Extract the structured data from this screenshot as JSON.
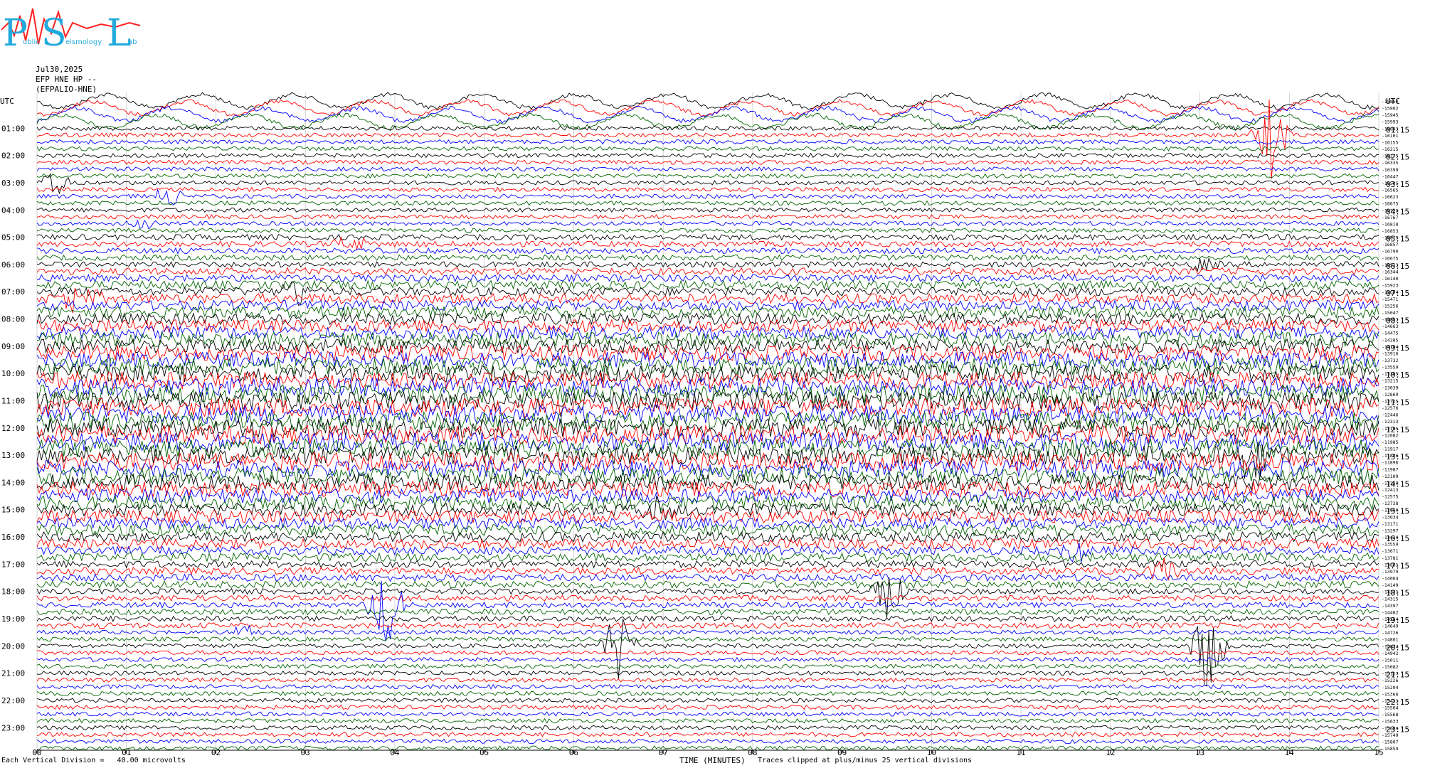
{
  "logo": {
    "text_p": "P",
    "text_s": "S",
    "text_l": "L",
    "small_a": "ublic",
    "small_b": "eismology",
    "small_c": "ab"
  },
  "header": {
    "date": "Jul30,2025",
    "station": "EFP HNE HP --",
    "channel": "(EFPALIO-HNE)",
    "utc_left": "UTC",
    "utc_right": "UTC"
  },
  "footer": {
    "division": "Each Vertical Division =   40.00 microvolts",
    "xlabel": "TIME (MINUTES)",
    "clip": "Traces clipped at plus/minus 25 vertical divisions"
  },
  "colors": [
    "#000000",
    "#ff0000",
    "#0000ff",
    "#006400"
  ],
  "chart_data": {
    "type": "line",
    "title": "Jul30,2025 EFP HNE HP -- (EFPALIO-HNE)",
    "xlabel": "TIME (MINUTES)",
    "xlim": [
      0,
      15
    ],
    "x_ticks": [
      "00",
      "01",
      "02",
      "03",
      "04",
      "05",
      "06",
      "07",
      "08",
      "09",
      "10",
      "11",
      "12",
      "13",
      "14",
      "15"
    ],
    "left_hour_labels": [
      "01:00",
      "02:00",
      "03:00",
      "04:00",
      "05:00",
      "06:00",
      "07:00",
      "08:00",
      "09:00",
      "10:00",
      "11:00",
      "12:00",
      "13:00",
      "14:00",
      "15:00",
      "16:00",
      "17:00",
      "18:00",
      "19:00",
      "20:00",
      "21:00",
      "22:00",
      "23:00"
    ],
    "right_hour_labels": [
      "01:15",
      "02:15",
      "03:15",
      "04:15",
      "05:15",
      "06:15",
      "07:15",
      "08:15",
      "09:15",
      "10:15",
      "11:15",
      "12:15",
      "13:15",
      "14:15",
      "15:15",
      "16:15",
      "17:15",
      "18:15",
      "19:15",
      "20:15",
      "21:15",
      "22:15",
      "23:15"
    ],
    "trace_minutes": 15,
    "trace_count": 96,
    "right_offsets": [
      -15860,
      -15902,
      -15945,
      -15993,
      -16043,
      -16101,
      -16155,
      -16215,
      -16275,
      -16335,
      -16399,
      -16447,
      -16505,
      -16565,
      -16623,
      -16675,
      -16728,
      -16767,
      -16818,
      -16853,
      -16879,
      -16857,
      -16790,
      -16675,
      -16523,
      -16344,
      -16140,
      -15923,
      -15694,
      -15471,
      -15256,
      -15047,
      -14853,
      -14663,
      -14475,
      -14285,
      -14104,
      -13916,
      -13732,
      -13559,
      -13385,
      -13215,
      -13039,
      -12869,
      -12725,
      -12576,
      -12446,
      -12313,
      -12195,
      -12082,
      -11985,
      -11917,
      -11886,
      -11896,
      -11987,
      -12109,
      -12258,
      -12413,
      -12575,
      -12738,
      -12890,
      -13034,
      -13171,
      -13297,
      -13430,
      -13559,
      -13671,
      -13781,
      -13881,
      -13979,
      -14064,
      -14149,
      -14231,
      -14315,
      -14397,
      -14482,
      -14564,
      -14649,
      -14726,
      -14801,
      -14874,
      -14942,
      -15011,
      -15082,
      -15157,
      -15226,
      -15294,
      -15366,
      -15433,
      -15504,
      -15568,
      -15633,
      -15689,
      -15749,
      -15807,
      -15859
    ],
    "noise_profile": [
      3,
      3,
      3,
      3,
      3,
      3,
      3,
      3,
      3,
      3,
      3,
      3,
      3,
      3,
      3,
      3,
      3,
      3,
      3,
      3,
      4,
      4,
      4,
      4,
      4,
      5,
      5,
      6,
      6,
      7,
      7,
      8,
      8,
      9,
      9,
      10,
      10,
      11,
      11,
      12,
      12,
      12,
      13,
      13,
      13,
      13,
      13,
      13,
      13,
      13,
      13,
      13,
      13,
      13,
      12,
      12,
      11,
      11,
      10,
      10,
      9,
      9,
      8,
      8,
      7,
      7,
      6,
      6,
      5,
      5,
      5,
      5,
      4,
      4,
      4,
      4,
      4,
      4,
      3,
      3,
      3,
      3,
      3,
      3,
      3,
      3,
      3,
      3,
      3,
      3,
      3,
      3,
      3,
      3,
      3,
      3
    ],
    "events": [
      {
        "trace": 14,
        "minute": 1.5,
        "amp": 18
      },
      {
        "trace": 18,
        "minute": 1.2,
        "amp": 10
      },
      {
        "trace": 21,
        "minute": 3.5,
        "amp": 14
      },
      {
        "trace": 28,
        "minute": 2.9,
        "amp": 22
      },
      {
        "trace": 29,
        "minute": 0.5,
        "amp": 30
      },
      {
        "trace": 12,
        "minute": 0.2,
        "amp": 20
      },
      {
        "trace": 5,
        "minute": 13.8,
        "amp": 60
      },
      {
        "trace": 24,
        "minute": 13.0,
        "amp": 12
      },
      {
        "trace": 52,
        "minute": 13.6,
        "amp": 50
      },
      {
        "trace": 60,
        "minute": 6.9,
        "amp": 20
      },
      {
        "trace": 72,
        "minute": 9.5,
        "amp": 40
      },
      {
        "trace": 74,
        "minute": 3.9,
        "amp": 60
      },
      {
        "trace": 80,
        "minute": 6.5,
        "amp": 55
      },
      {
        "trace": 80,
        "minute": 13.1,
        "amp": 70
      },
      {
        "trace": 69,
        "minute": 12.6,
        "amp": 25
      },
      {
        "trace": 66,
        "minute": 11.6,
        "amp": 18
      },
      {
        "trace": 78,
        "minute": 2.3,
        "amp": 14
      }
    ]
  }
}
